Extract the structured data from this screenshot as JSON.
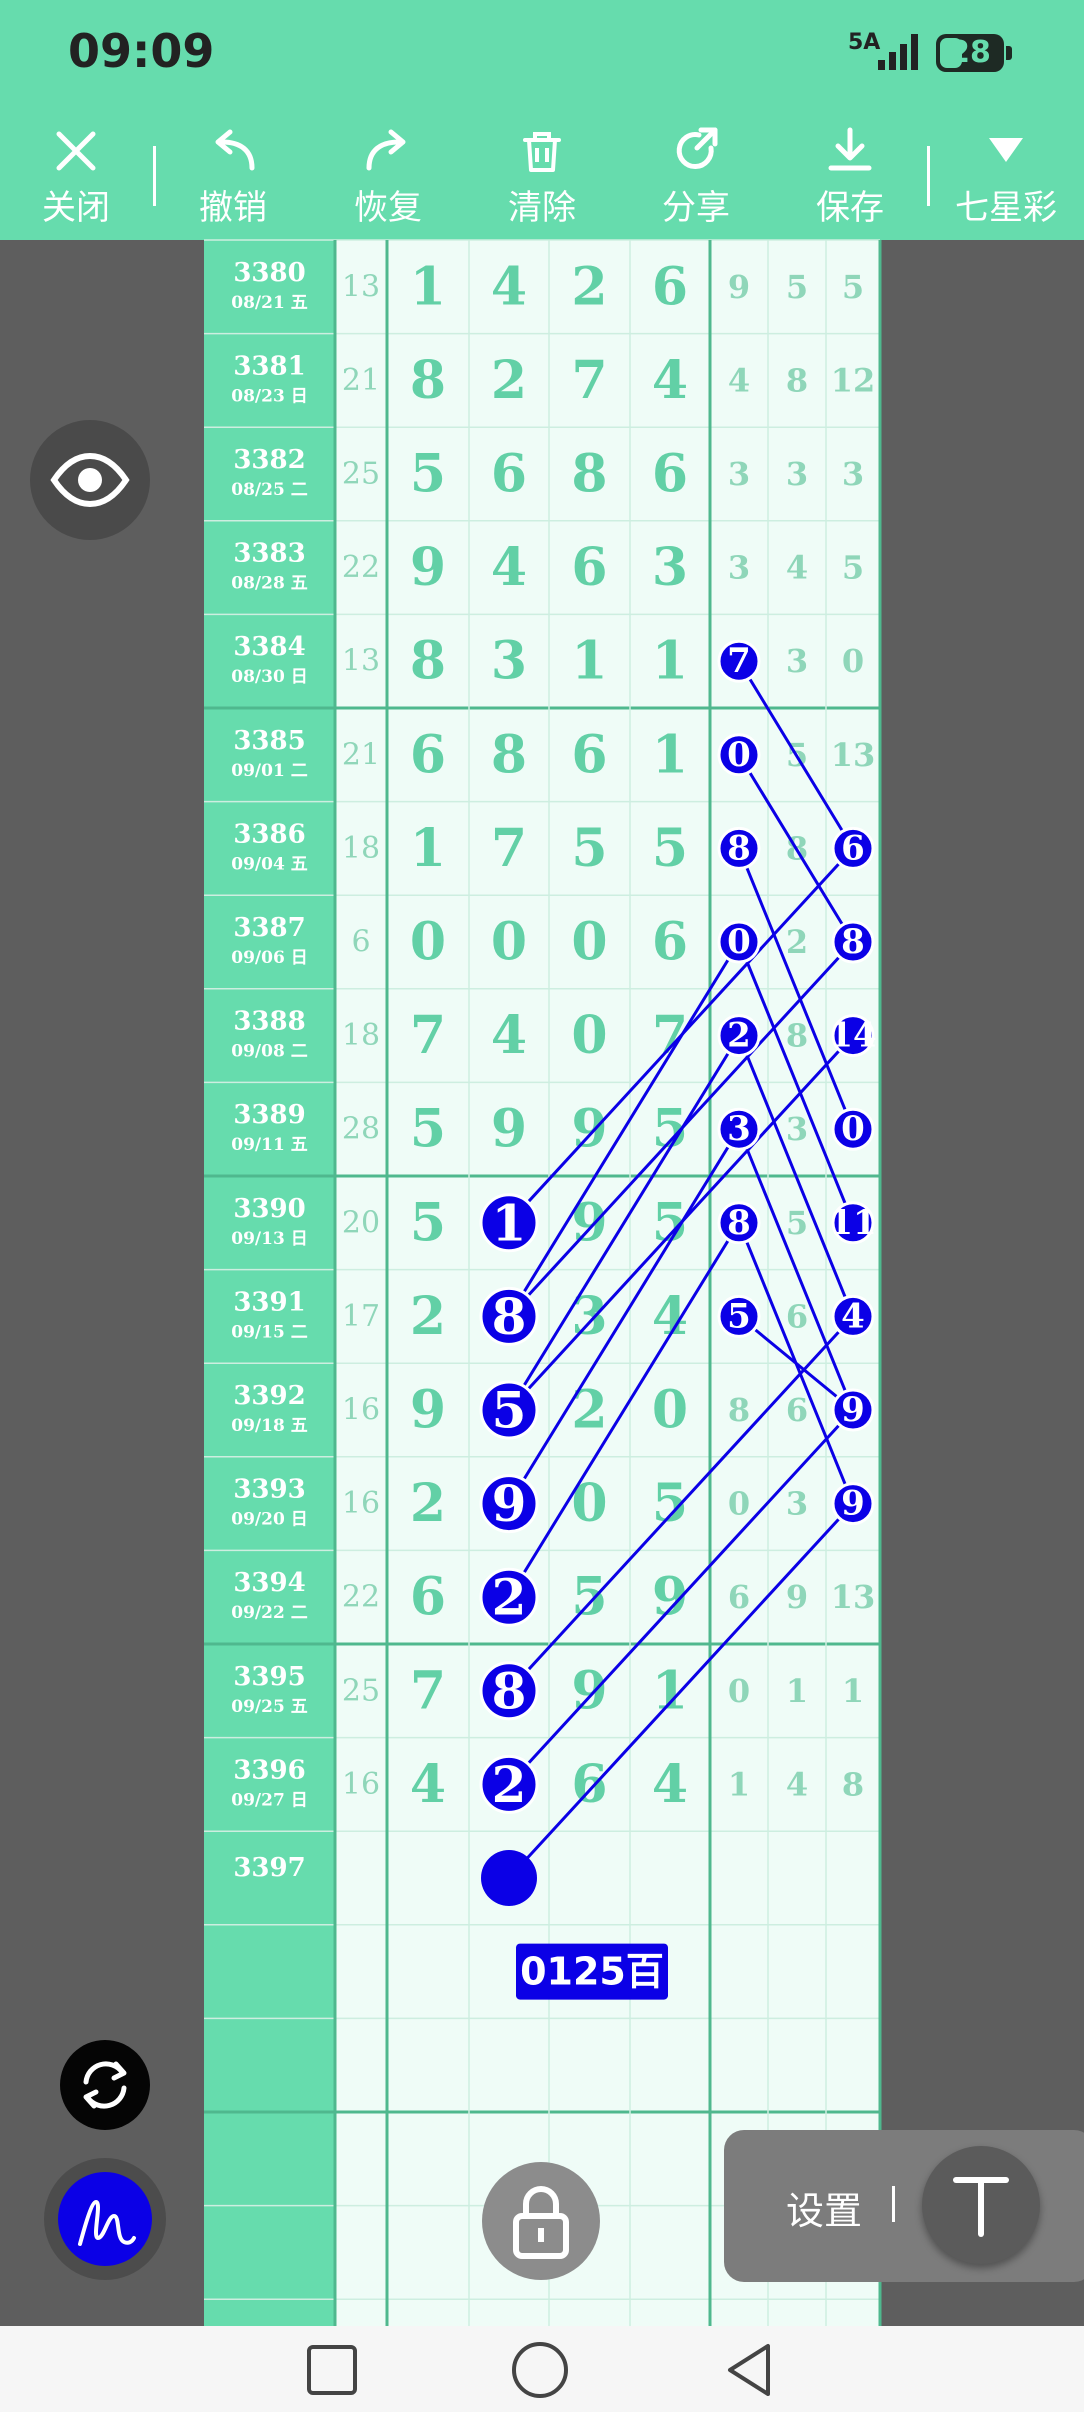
{
  "status_bar": {
    "time": "09:09",
    "network": "5A",
    "battery": "28"
  },
  "toolbar": {
    "close": "关闭",
    "undo": "撤销",
    "redo": "恢复",
    "clear": "清除",
    "share": "分享",
    "save": "保存",
    "lottery": "七星彩"
  },
  "table": {
    "rows": [
      {
        "issue": "3380",
        "date": "08/21 五",
        "sum": 13,
        "digits": [
          1,
          4,
          2,
          6
        ],
        "extra": [
          9,
          5,
          5
        ]
      },
      {
        "issue": "3381",
        "date": "08/23 日",
        "sum": 21,
        "digits": [
          8,
          2,
          7,
          4
        ],
        "extra": [
          4,
          8,
          12
        ]
      },
      {
        "issue": "3382",
        "date": "08/25 二",
        "sum": 25,
        "digits": [
          5,
          6,
          8,
          6
        ],
        "extra": [
          3,
          3,
          3
        ]
      },
      {
        "issue": "3383",
        "date": "08/28 五",
        "sum": 22,
        "digits": [
          9,
          4,
          6,
          3
        ],
        "extra": [
          3,
          4,
          5
        ]
      },
      {
        "issue": "3384",
        "date": "08/30 日",
        "sum": 13,
        "digits": [
          8,
          3,
          1,
          1
        ],
        "extra": [
          7,
          3,
          0
        ]
      },
      {
        "issue": "3385",
        "date": "09/01 二",
        "sum": 21,
        "digits": [
          6,
          8,
          6,
          1
        ],
        "extra": [
          0,
          5,
          13
        ]
      },
      {
        "issue": "3386",
        "date": "09/04 五",
        "sum": 18,
        "digits": [
          1,
          7,
          5,
          5
        ],
        "extra": [
          8,
          8,
          6
        ]
      },
      {
        "issue": "3387",
        "date": "09/06 日",
        "sum": 6,
        "digits": [
          0,
          0,
          0,
          6
        ],
        "extra": [
          0,
          2,
          8
        ]
      },
      {
        "issue": "3388",
        "date": "09/08 二",
        "sum": 18,
        "digits": [
          7,
          4,
          0,
          7
        ],
        "extra": [
          2,
          8,
          14
        ]
      },
      {
        "issue": "3389",
        "date": "09/11 五",
        "sum": 28,
        "digits": [
          5,
          9,
          9,
          5
        ],
        "extra": [
          3,
          3,
          0
        ]
      },
      {
        "issue": "3390",
        "date": "09/13 日",
        "sum": 20,
        "digits": [
          5,
          1,
          9,
          5
        ],
        "extra": [
          8,
          5,
          11
        ]
      },
      {
        "issue": "3391",
        "date": "09/15 二",
        "sum": 17,
        "digits": [
          2,
          8,
          3,
          4
        ],
        "extra": [
          5,
          6,
          4
        ]
      },
      {
        "issue": "3392",
        "date": "09/18 五",
        "sum": 16,
        "digits": [
          9,
          5,
          2,
          0
        ],
        "extra": [
          8,
          6,
          9
        ]
      },
      {
        "issue": "3393",
        "date": "09/20 日",
        "sum": 16,
        "digits": [
          2,
          9,
          0,
          5
        ],
        "extra": [
          0,
          3,
          9
        ]
      },
      {
        "issue": "3394",
        "date": "09/22 二",
        "sum": 22,
        "digits": [
          6,
          2,
          5,
          9
        ],
        "extra": [
          6,
          9,
          13
        ]
      },
      {
        "issue": "3395",
        "date": "09/25 五",
        "sum": 25,
        "digits": [
          7,
          8,
          9,
          1
        ],
        "extra": [
          0,
          1,
          1
        ]
      },
      {
        "issue": "3396",
        "date": "09/27 日",
        "sum": 16,
        "digits": [
          4,
          2,
          6,
          4
        ],
        "extra": [
          1,
          4,
          8
        ]
      },
      {
        "issue": "3397",
        "date": "",
        "sum": null,
        "digits": [],
        "extra": []
      }
    ],
    "highlights": [
      {
        "row": 10,
        "col": "d1"
      },
      {
        "row": 11,
        "col": "d1"
      },
      {
        "row": 12,
        "col": "d1"
      },
      {
        "row": 13,
        "col": "d1"
      },
      {
        "row": 14,
        "col": "d1"
      },
      {
        "row": 15,
        "col": "d1"
      },
      {
        "row": 16,
        "col": "d1"
      },
      {
        "row": 4,
        "col": "e0"
      },
      {
        "row": 5,
        "col": "e0"
      },
      {
        "row": 6,
        "col": "e0"
      },
      {
        "row": 7,
        "col": "e0"
      },
      {
        "row": 8,
        "col": "e0"
      },
      {
        "row": 9,
        "col": "e0"
      },
      {
        "row": 10,
        "col": "e0"
      },
      {
        "row": 11,
        "col": "e0"
      },
      {
        "row": 6,
        "col": "e2"
      },
      {
        "row": 7,
        "col": "e2"
      },
      {
        "row": 8,
        "col": "e2"
      },
      {
        "row": 9,
        "col": "e2"
      },
      {
        "row": 10,
        "col": "e2"
      },
      {
        "row": 11,
        "col": "e2"
      },
      {
        "row": 12,
        "col": "e2"
      },
      {
        "row": 13,
        "col": "e2"
      }
    ],
    "prediction_dot": {
      "row": 17,
      "col": "d1"
    },
    "prediction_tag": "0125百"
  },
  "colors": {
    "accent": "#66dcad",
    "mark": "#0b00e6",
    "dark_bg": "#5e5e5e"
  },
  "floating": {
    "eye": "eye-icon",
    "refresh": "refresh-icon",
    "pen": "pen-icon",
    "lock": "lock-icon",
    "settings": "设置",
    "text": "text-tool-icon"
  },
  "nav": {
    "recents": "square-icon",
    "home": "circle-icon",
    "back": "triangle-back-icon"
  }
}
